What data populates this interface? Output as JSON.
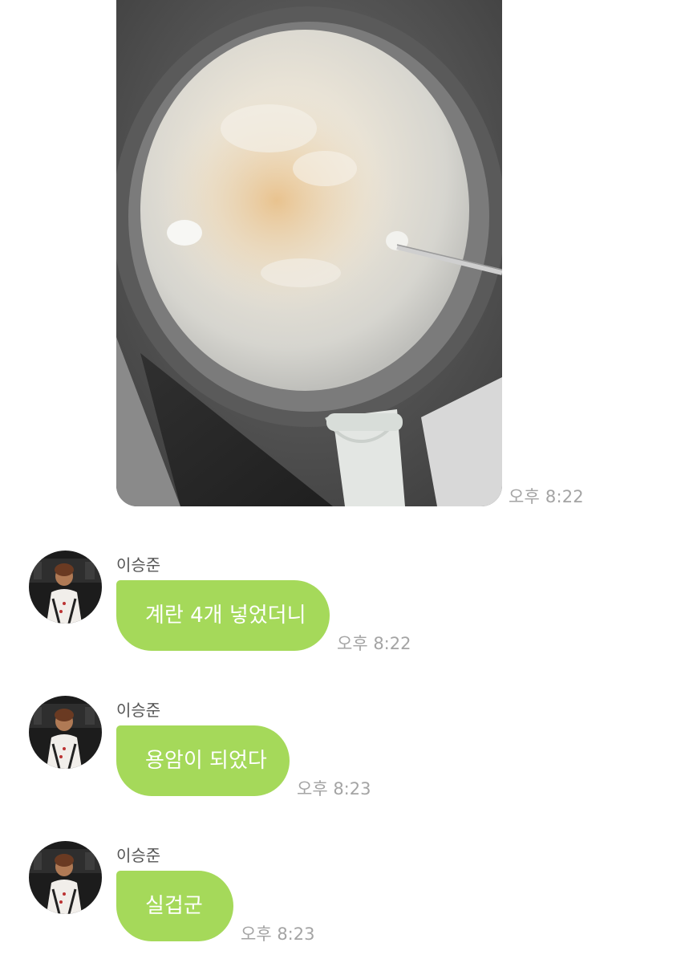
{
  "photo_message": {
    "time": "오후 8:22"
  },
  "messages": [
    {
      "sender": "이승준",
      "text": "계란 4개 넣었더니",
      "time": "오후 8:22"
    },
    {
      "sender": "이승준",
      "text": "용암이 되었다",
      "time": "오후 8:23"
    },
    {
      "sender": "이승준",
      "text": "실겁군",
      "time": "오후 8:23"
    }
  ],
  "colors": {
    "bubble": "#a5d95a",
    "timestamp": "#a4a4a4",
    "sender": "#555555"
  },
  "icons": {
    "avatar": "profile-photo",
    "photo": "pot-of-boiling-food"
  }
}
